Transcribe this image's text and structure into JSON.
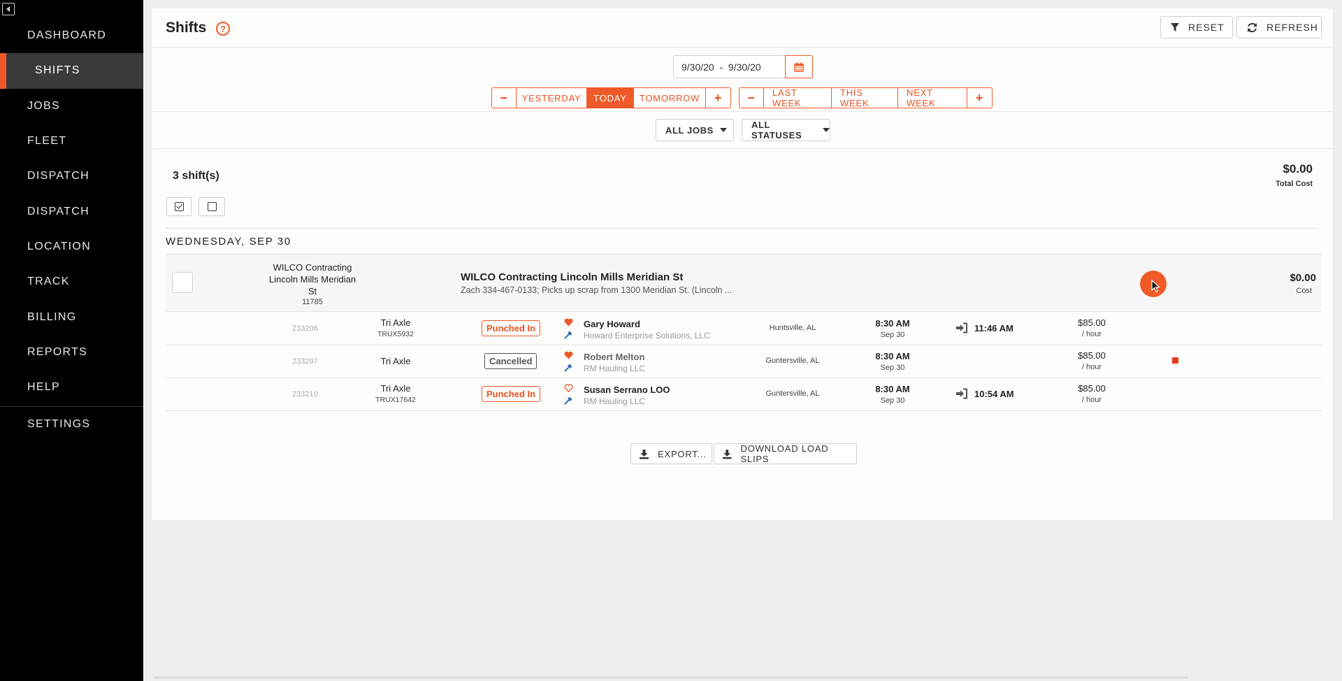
{
  "sidebar": {
    "items": [
      {
        "label": "DASHBOARD"
      },
      {
        "label": "SHIFTS"
      },
      {
        "label": "JOBS"
      },
      {
        "label": "FLEET"
      },
      {
        "label": "DISPATCH"
      },
      {
        "label": "DISPATCH"
      },
      {
        "label": "LOCATION"
      },
      {
        "label": "TRACK"
      },
      {
        "label": "BILLING"
      },
      {
        "label": "REPORTS"
      },
      {
        "label": "HELP"
      }
    ],
    "settings_label": "SETTINGS",
    "active_index": 1
  },
  "header": {
    "title": "Shifts",
    "help_glyph": "?",
    "reset_label": "RESET",
    "refresh_label": "REFRESH"
  },
  "date_filter": {
    "range": "9/30/20  -  9/30/20",
    "day_group": {
      "minus": "−",
      "yesterday": "YESTERDAY",
      "today": "TODAY",
      "tomorrow": "TOMORROW",
      "plus": "+"
    },
    "week_group": {
      "minus": "−",
      "last_week": "LAST WEEK",
      "this_week": "THIS WEEK",
      "next_week": "NEXT WEEK",
      "plus": "+"
    },
    "active": "TODAY"
  },
  "filters": {
    "jobs": "ALL JOBS",
    "statuses": "ALL STATUSES"
  },
  "summary": {
    "shift_count": "3 shift(s)",
    "total_cost": "$0.00",
    "total_cost_label": "Total Cost"
  },
  "day": {
    "label": "WEDNESDAY, SEP 30"
  },
  "job": {
    "customer_lines": [
      "WILCO Contracting",
      "Lincoln Mills Meridian",
      "St"
    ],
    "job_number": "11785",
    "title": "WILCO Contracting Lincoln Mills Meridian St",
    "description": "Zach 334-467-0133; Picks up scrap from 1300 Meridian St. (Lincoln ...",
    "cost": "$0.00",
    "cost_label": "Cost"
  },
  "shifts": [
    {
      "id": "233206",
      "truck_type": "Tri Axle",
      "plate": "TRUX5932",
      "status": "Punched In",
      "favorite": true,
      "driver": "Gary Howard",
      "company": "Howard Enterprise Solutions, LLC",
      "location": "Huntsville, AL",
      "start_time": "8:30 AM",
      "start_date": "Sep 30",
      "punch_time": "11:46 AM",
      "rate": "$85.00",
      "rate_unit": "/ hour",
      "has_note": false
    },
    {
      "id": "233207",
      "truck_type": "Tri Axle",
      "plate": "",
      "status": "Cancelled",
      "favorite": true,
      "driver": "Robert Melton",
      "company": "RM Hauling LLC",
      "location": "Guntersville, AL",
      "start_time": "8:30 AM",
      "start_date": "Sep 30",
      "punch_time": "",
      "rate": "$85.00",
      "rate_unit": "/ hour",
      "has_note": true
    },
    {
      "id": "233210",
      "truck_type": "Tri Axle",
      "plate": "TRUX17642",
      "status": "Punched In",
      "favorite": false,
      "driver": "Susan Serrano LOO",
      "company": "RM Hauling LLC",
      "location": "Guntersville, AL",
      "start_time": "8:30 AM",
      "start_date": "Sep 30",
      "punch_time": "10:54 AM",
      "rate": "$85.00",
      "rate_unit": "/ hour",
      "has_note": false
    }
  ],
  "actions": {
    "export_label": "EXPORT...",
    "download_label": "DOWNLOAD LOAD SLIPS"
  },
  "colors": {
    "accent": "#f05a28",
    "sidebar_bg": "#000000",
    "active_nav_bg": "#3a3a3a",
    "note_red": "#e53a1f"
  },
  "icons": {
    "collapse": "collapse-sidebar-icon",
    "help": "help-circle-icon",
    "reset": "filter-icon",
    "refresh": "refresh-icon",
    "calendar": "calendar-icon",
    "favorite": "heart-icon",
    "role": "hammer-icon",
    "punch": "sign-in-icon",
    "export": "download-icon",
    "note": "note-icon"
  }
}
